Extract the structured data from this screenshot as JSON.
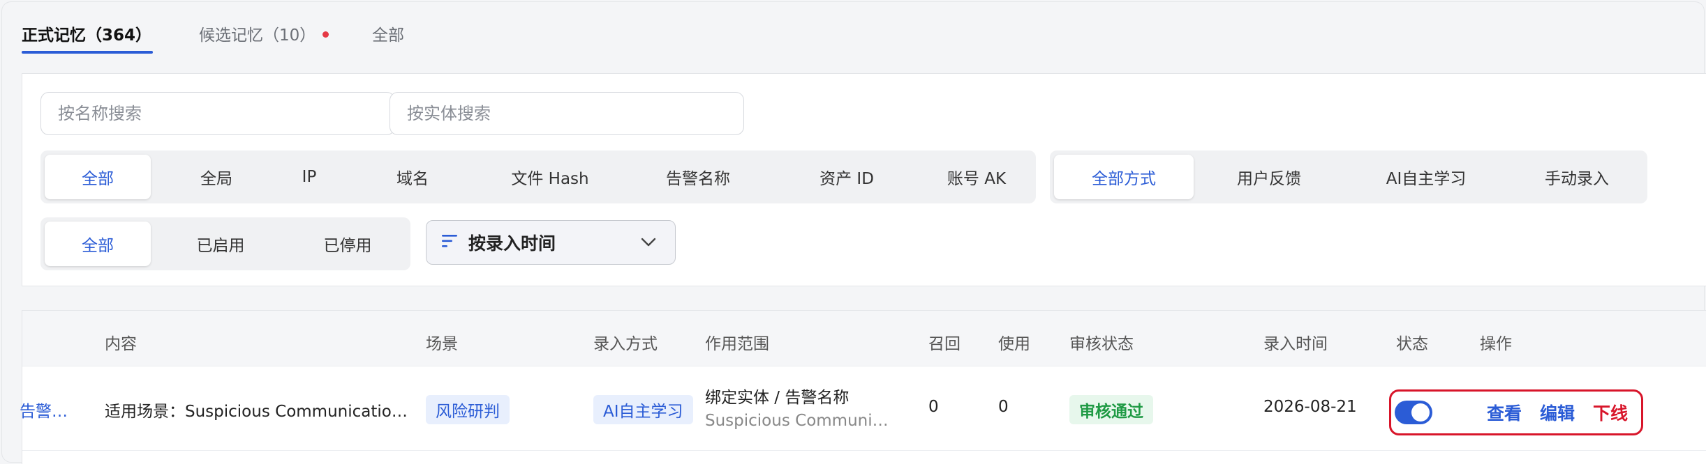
{
  "tabs": {
    "formal": "正式记忆（364）",
    "candidate": "候选记忆（10）",
    "all": "全部"
  },
  "search": {
    "by_name_placeholder": "按名称搜索",
    "by_entity_placeholder": "按实体搜索"
  },
  "scope_filter": {
    "items": [
      "全部",
      "全局",
      "IP",
      "域名",
      "文件 Hash",
      "告警名称",
      "资产 ID",
      "账号 AK"
    ],
    "selected": "全部"
  },
  "method_filter": {
    "items": [
      "全部方式",
      "用户反馈",
      "AI自主学习",
      "手动录入"
    ],
    "selected": "全部方式"
  },
  "status_filter": {
    "items": [
      "全部",
      "已启用",
      "已停用"
    ],
    "selected": "全部"
  },
  "sort": {
    "label": "按录入时间",
    "icon": "sort-lines-icon"
  },
  "table": {
    "columns": {
      "content": "内容",
      "scene": "场景",
      "method": "录入方式",
      "scope": "作用范围",
      "recall": "召回",
      "usage": "使用",
      "review": "审核状态",
      "time": "录入时间",
      "status": "状态",
      "actions": "操作"
    },
    "rows": [
      {
        "name_trunc": "告警…",
        "content": "适用场景：Suspicious Communicatio…",
        "scene": "风险研判",
        "method": "AI自主学习",
        "scope_main": "绑定实体 / 告警名称",
        "scope_sub": "Suspicious Communi…",
        "recall": "0",
        "usage": "0",
        "review": "审核通过",
        "time": "2026-08-21",
        "enabled": true,
        "actions": {
          "view": "查看",
          "edit": "编辑",
          "offline": "下线"
        }
      }
    ]
  },
  "colors": {
    "accent": "#2b5cd6",
    "danger": "#d8152a",
    "success": "#1f9a44"
  }
}
